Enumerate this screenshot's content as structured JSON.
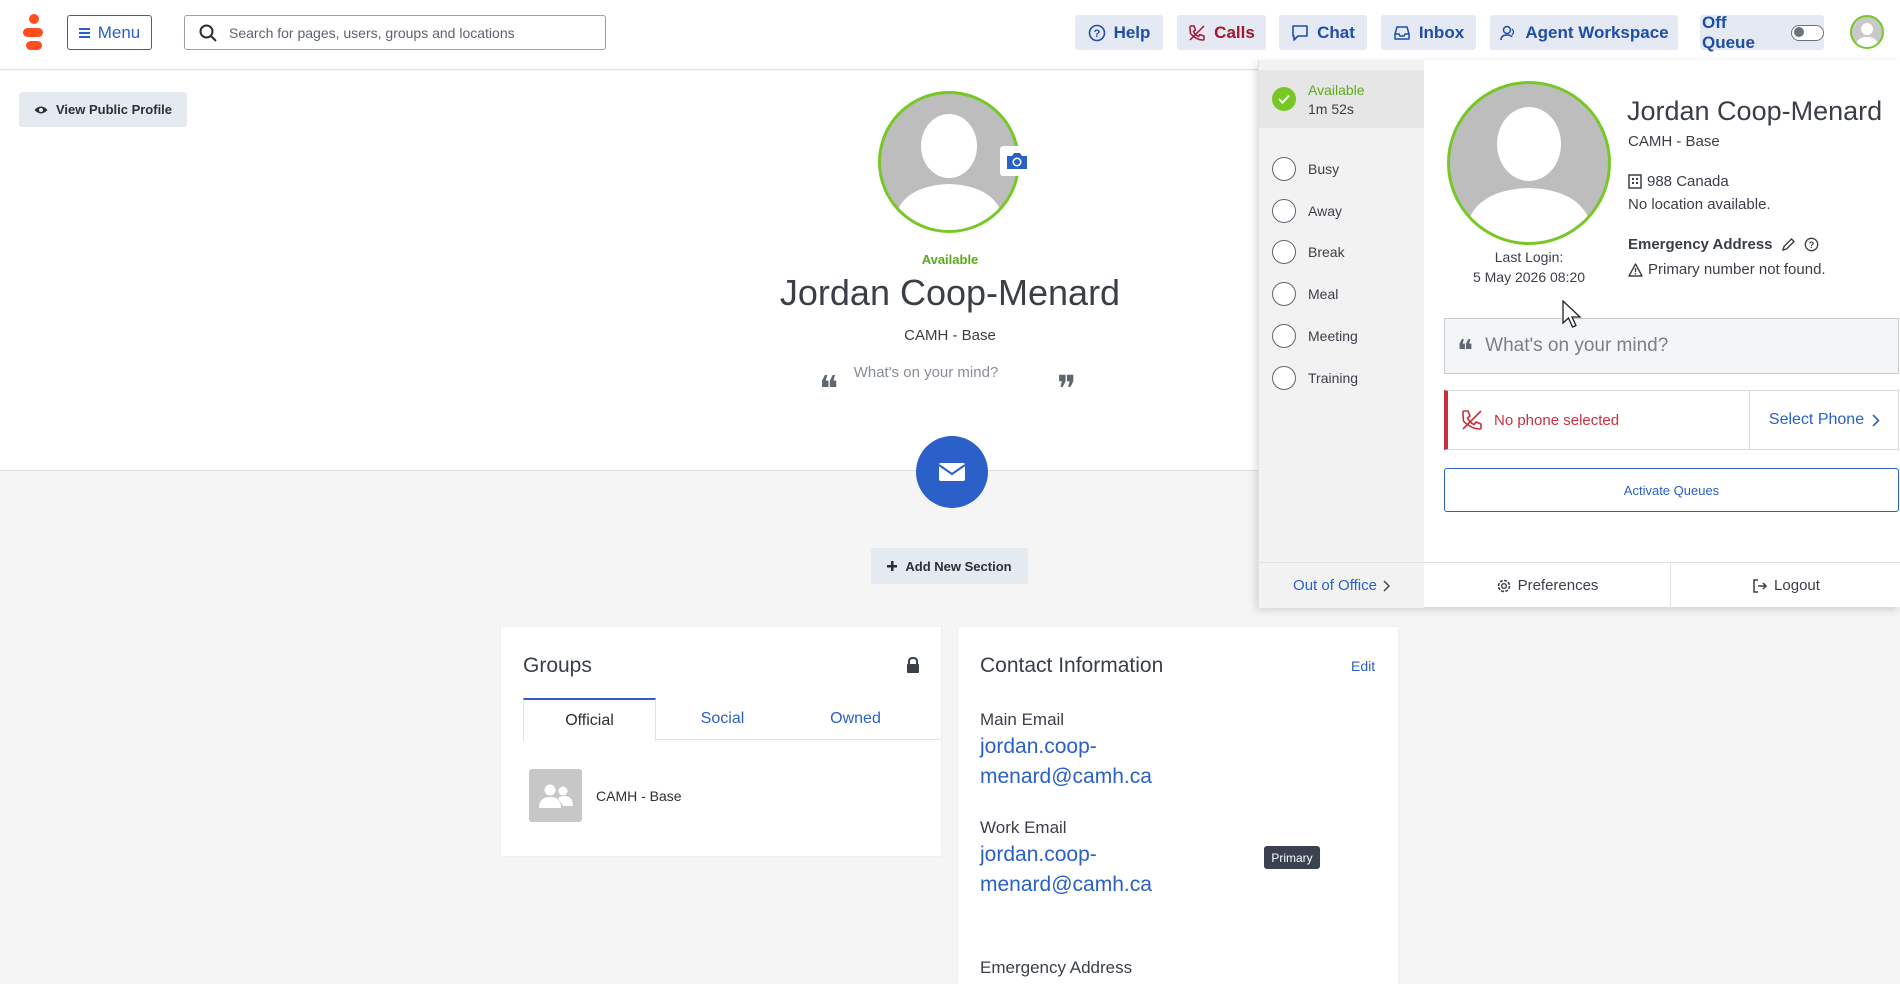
{
  "header": {
    "menu_label": "Menu",
    "search_placeholder": "Search for pages, users, groups and locations",
    "buttons": [
      {
        "label": "Help",
        "icon": "help-circle-icon"
      },
      {
        "label": "Calls",
        "icon": "phone-missed-icon"
      },
      {
        "label": "Chat",
        "icon": "chat-bubble-icon"
      },
      {
        "label": "Inbox",
        "icon": "inbox-icon"
      },
      {
        "label": "Agent Workspace",
        "icon": "agent-icon"
      }
    ],
    "queue_label": "Off Queue",
    "brand_color": "#ff4f1f",
    "accent_color": "#2a60c8"
  },
  "profile": {
    "view_public_label": "View Public Profile",
    "status": "Available",
    "name": "Jordan Coop-Menard",
    "org": "CAMH - Base",
    "mind_placeholder": "What's on your mind?",
    "add_section_label": "Add New Section"
  },
  "groups": {
    "title": "Groups",
    "tabs": [
      "Official",
      "Social",
      "Owned"
    ],
    "active_tab": "Official",
    "items": [
      {
        "name": "CAMH - Base"
      }
    ]
  },
  "contact": {
    "title": "Contact Information",
    "edit_label": "Edit",
    "fields": [
      {
        "label": "Main Email",
        "value_line1": "jordan.coop-",
        "value_line2": "menard@camh.ca"
      },
      {
        "label": "Work Email",
        "value_line1": "jordan.coop-",
        "value_line2": "menard@camh.ca",
        "badge": "Primary"
      },
      {
        "label": "Emergency Address"
      }
    ]
  },
  "presence_panel": {
    "statuses": [
      {
        "label": "Available",
        "duration": "1m 52s",
        "selected": true
      },
      {
        "label": "Busy"
      },
      {
        "label": "Away"
      },
      {
        "label": "Break"
      },
      {
        "label": "Meal"
      },
      {
        "label": "Meeting"
      },
      {
        "label": "Training"
      }
    ],
    "last_login_label": "Last Login:",
    "last_login_value": "5 May 2026 08:20",
    "name": "Jordan Coop-Menard",
    "org": "CAMH - Base",
    "location": "988 Canada",
    "no_location": "No location available.",
    "emergency_label": "Emergency Address",
    "primary_warning": "Primary number not found.",
    "mind_placeholder": "What's on your mind?",
    "no_phone": "No phone selected",
    "select_phone": "Select Phone",
    "activate_queues": "Activate Queues",
    "footer": {
      "out_of_office": "Out of Office",
      "preferences": "Preferences",
      "logout": "Logout"
    },
    "available_color": "#77c726",
    "error_color": "#c8303f"
  }
}
